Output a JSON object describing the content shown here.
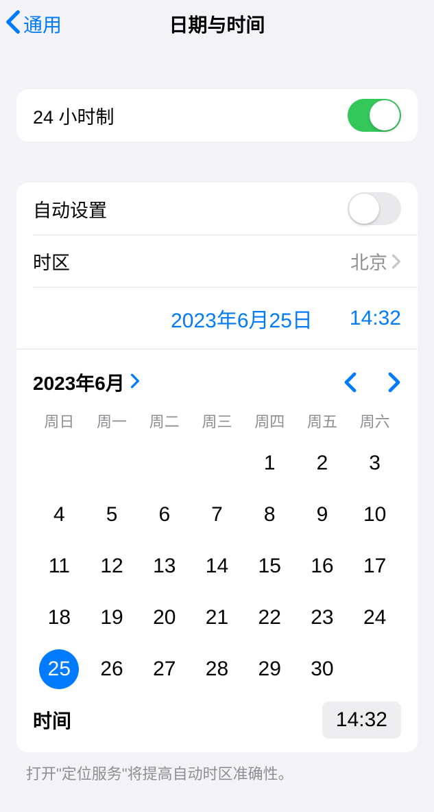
{
  "nav": {
    "back_label": "通用",
    "title": "日期与时间"
  },
  "hour24": {
    "label": "24 小时制",
    "on": true
  },
  "autoset": {
    "label": "自动设置",
    "on": false
  },
  "timezone": {
    "label": "时区",
    "value": "北京"
  },
  "datetime": {
    "date_display": "2023年6月25日",
    "time_display": "14:32"
  },
  "calendar": {
    "month_label": "2023年6月",
    "weekdays": [
      "周日",
      "周一",
      "周二",
      "周三",
      "周四",
      "周五",
      "周六"
    ],
    "first_weekday": 4,
    "days_in_month": 30,
    "selected_day": 25
  },
  "time_row": {
    "label": "时间",
    "value": "14:32"
  },
  "footer": "打开\"定位服务\"将提高自动时区准确性。"
}
